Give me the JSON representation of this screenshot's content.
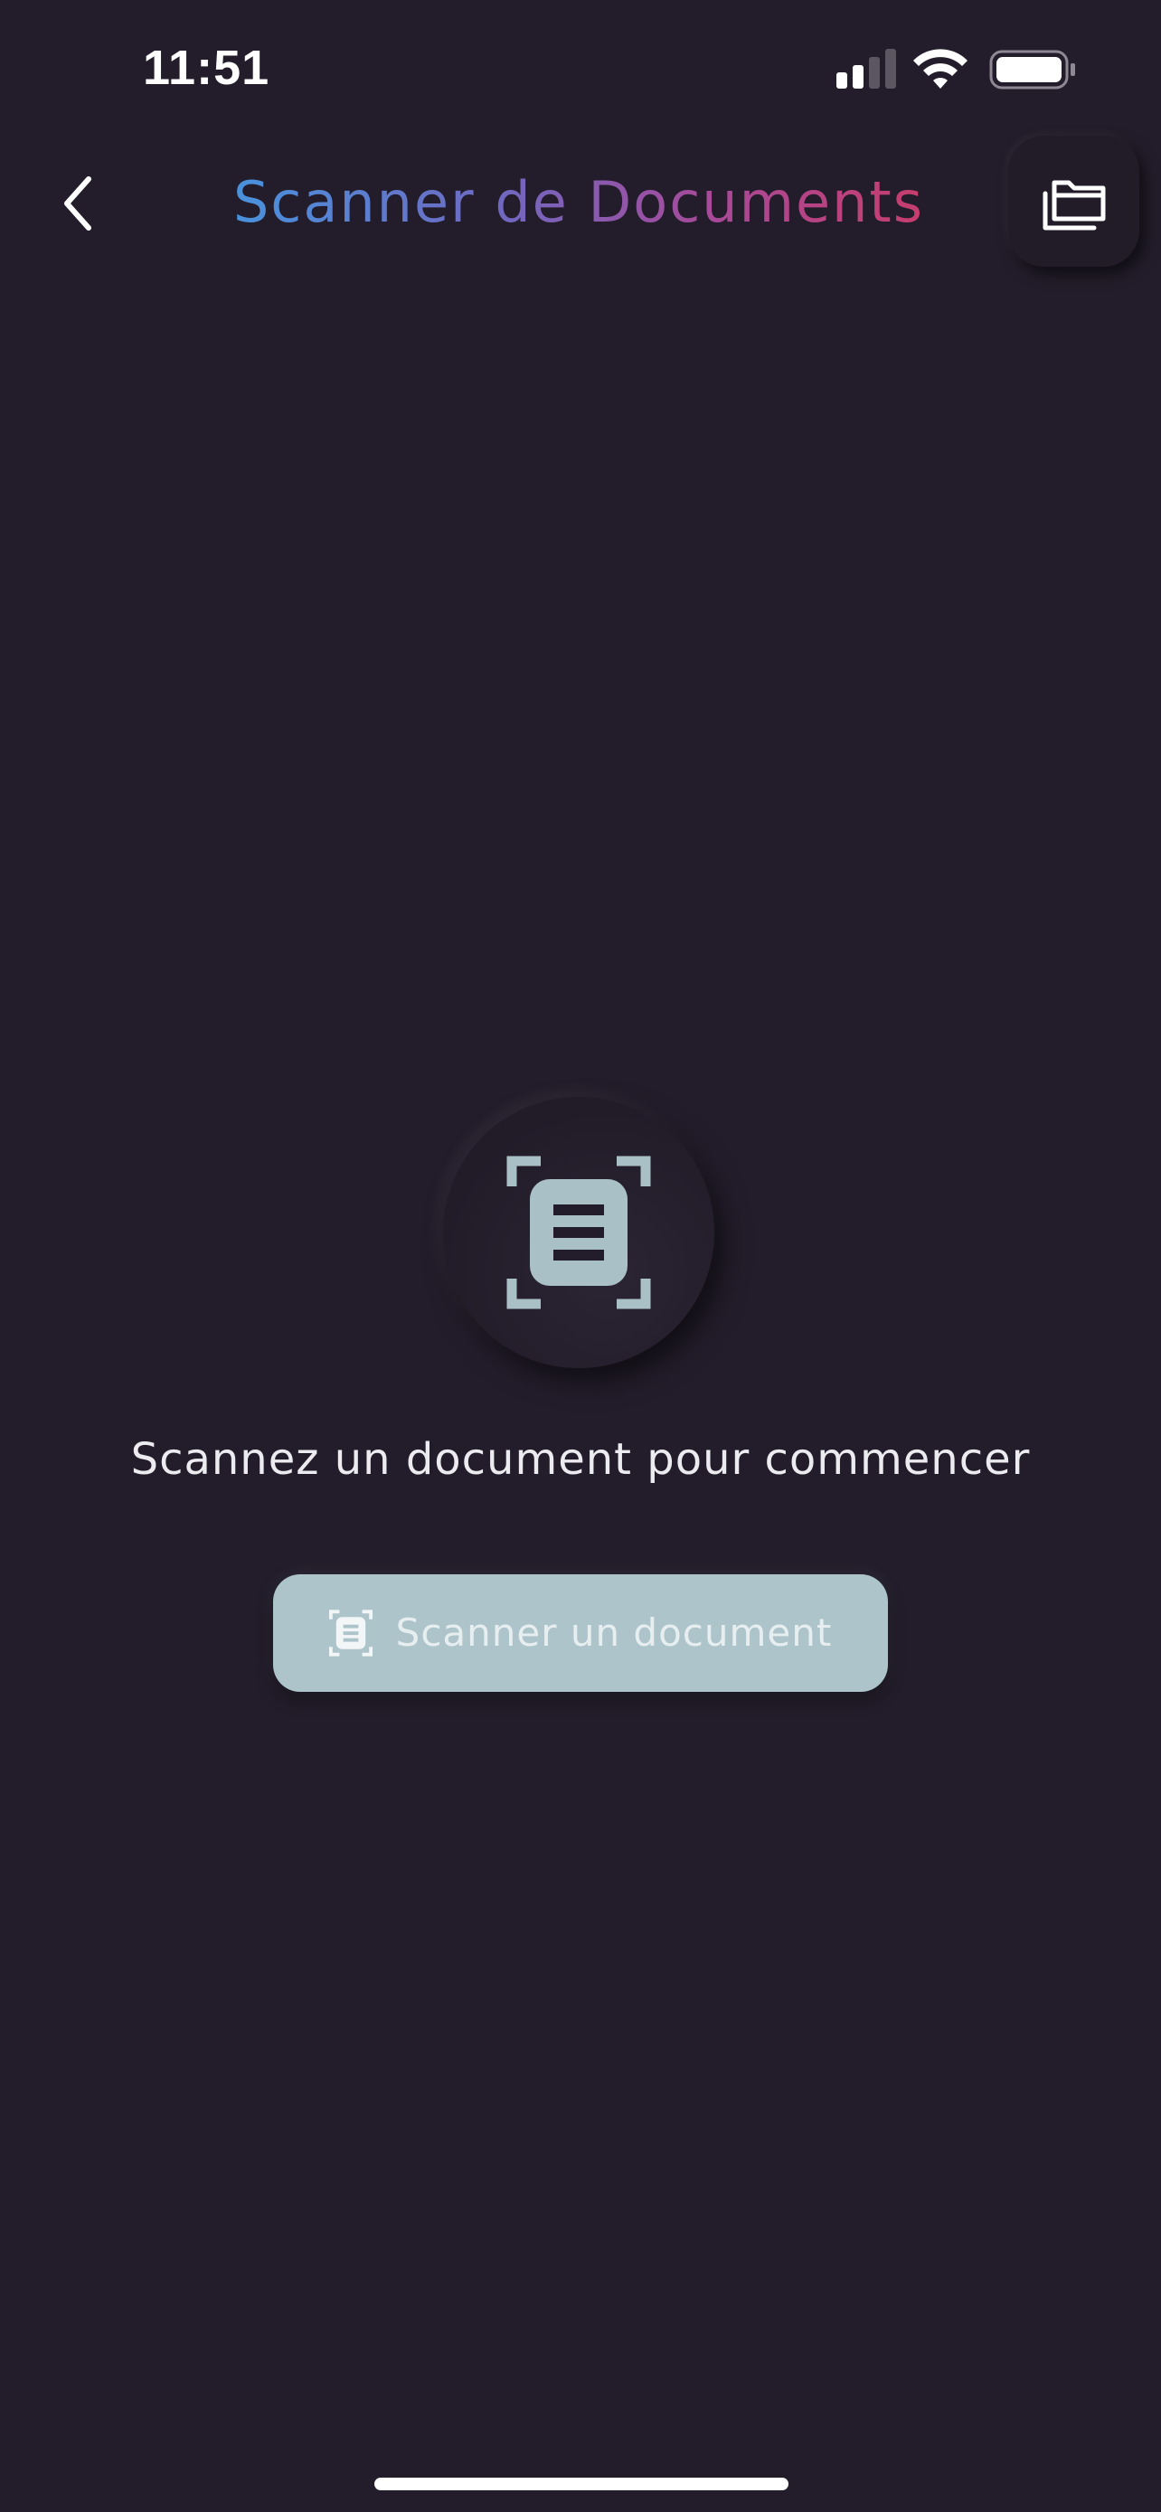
{
  "status_bar": {
    "time": "11:51",
    "icons": [
      "signal-icon",
      "wifi-icon",
      "battery-icon"
    ]
  },
  "header": {
    "title": "Scanner de Documents",
    "back_icon": "chevron-left-icon",
    "folder_icon": "folders-icon",
    "title_gradient": [
      "#3f9de3",
      "#6f69c1",
      "#a64a9a",
      "#d1395f"
    ]
  },
  "empty_state": {
    "icon": "document-scanner-icon",
    "message": "Scannez un document pour commencer"
  },
  "scan_button": {
    "label": "Scanner un document",
    "icon": "document-scanner-icon"
  },
  "colors": {
    "background": "#231d2b",
    "accent": "#adc4cb"
  }
}
